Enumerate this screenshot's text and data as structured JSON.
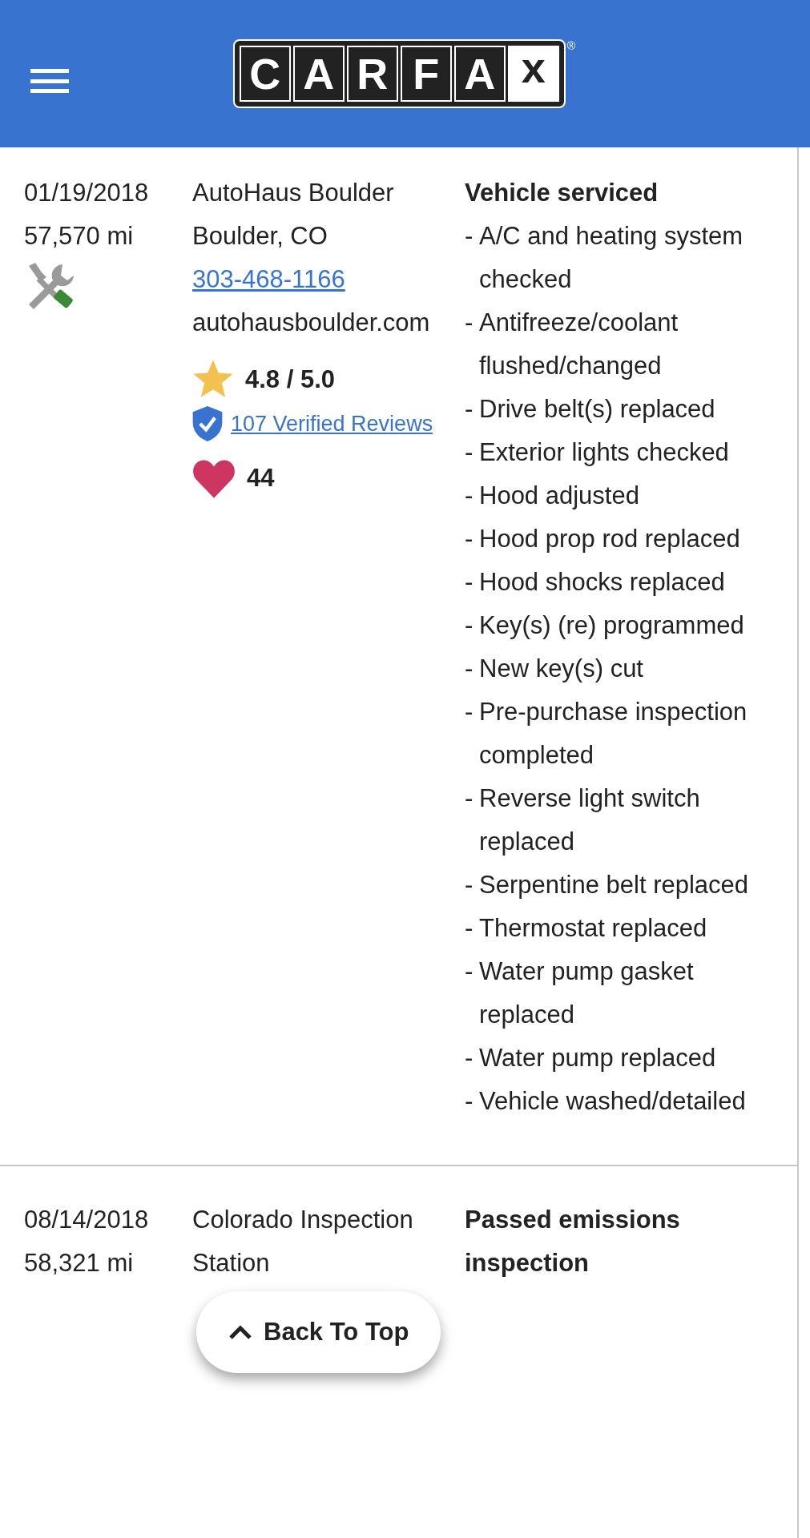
{
  "header": {
    "logo_letters": [
      "C",
      "A",
      "R",
      "F",
      "A",
      "x"
    ],
    "registered_mark": "®"
  },
  "records": [
    {
      "date": "01/19/2018",
      "mileage": "57,570 mi",
      "kind": "service",
      "source_name": "AutoHaus Boulder",
      "source_location": "Boulder, CO",
      "phone": "303-468-1166",
      "website": "autohausboulder.com",
      "rating": "4.8 / 5.0",
      "reviews": "107 Verified Reviews",
      "favorites": "44",
      "title": "Vehicle serviced",
      "detail_marker": "-",
      "details": [
        "A/C and heating system checked",
        "Antifreeze/coolant flushed/changed",
        "Drive belt(s) replaced",
        "Exterior lights checked",
        "Hood adjusted",
        "Hood prop rod replaced",
        "Hood shocks replaced",
        "Key(s) (re) programmed",
        "New key(s) cut",
        "Pre-purchase inspection completed",
        "Reverse light switch replaced",
        "Serpentine belt replaced",
        "Thermostat replaced",
        "Water pump gasket replaced",
        "Water pump replaced",
        "Vehicle washed/detailed"
      ]
    },
    {
      "date": "08/14/2018",
      "mileage": "58,321 mi",
      "kind": "emissions",
      "source_name": "Colorado Inspection Station",
      "title": "Passed emissions inspection"
    }
  ],
  "back_to_top": "Back To Top"
}
